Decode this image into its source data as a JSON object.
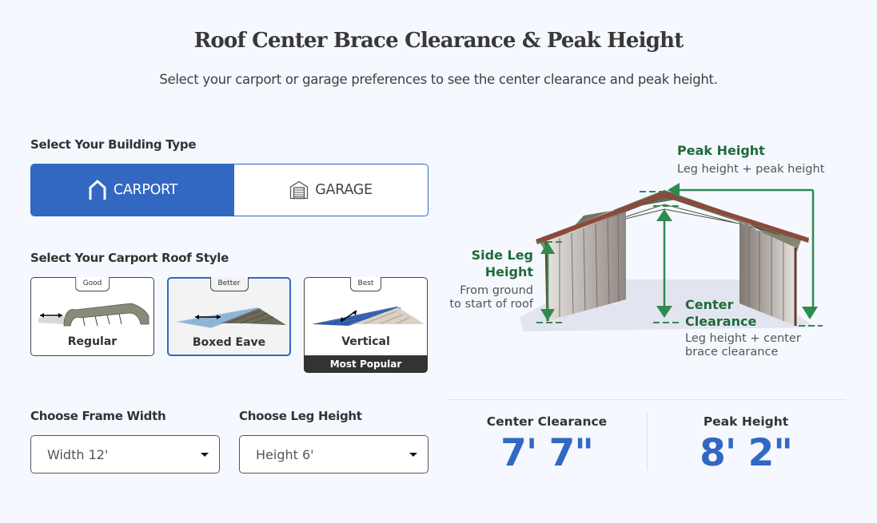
{
  "header": {
    "title": "Roof Center Brace Clearance & Peak Height",
    "subtitle": "Select your carport or garage preferences to see the center clearance and peak height."
  },
  "building_type": {
    "label": "Select Your Building Type",
    "options": [
      {
        "label": "CARPORT",
        "icon": "carport-icon",
        "selected": true
      },
      {
        "label": "GARAGE",
        "icon": "garage-icon",
        "selected": false
      }
    ]
  },
  "roof_style": {
    "label": "Select Your Carport Roof Style",
    "options": [
      {
        "tag": "Good",
        "name": "Regular",
        "selected": false
      },
      {
        "tag": "Better",
        "name": "Boxed Eave",
        "selected": true
      },
      {
        "tag": "Best",
        "name": "Vertical",
        "selected": false,
        "badge": "Most Popular"
      }
    ]
  },
  "frame_width": {
    "label": "Choose Frame Width",
    "value": "Width 12'"
  },
  "leg_height": {
    "label": "Choose Leg Height",
    "value": "Height 6'"
  },
  "diagram": {
    "peak_title": "Peak Height",
    "peak_desc": "Leg height + peak height",
    "side_title_1": "Side Leg",
    "side_title_2": "Height",
    "side_desc_1": "From ground",
    "side_desc_2": "to start of roof",
    "center_title_1": "Center",
    "center_title_2": "Clearance",
    "center_desc_1": "Leg height + center",
    "center_desc_2": "brace clearance",
    "arrow_color": "#2e8b4e",
    "label_color": "#1f6b3a"
  },
  "results": {
    "center_label": "Center Clearance",
    "center_value": "7' 7\"",
    "peak_label": "Peak Height",
    "peak_value": "8' 2\""
  },
  "colors": {
    "accent": "#3268c2",
    "background": "#f5f8fe",
    "dark_badge": "#333333"
  }
}
